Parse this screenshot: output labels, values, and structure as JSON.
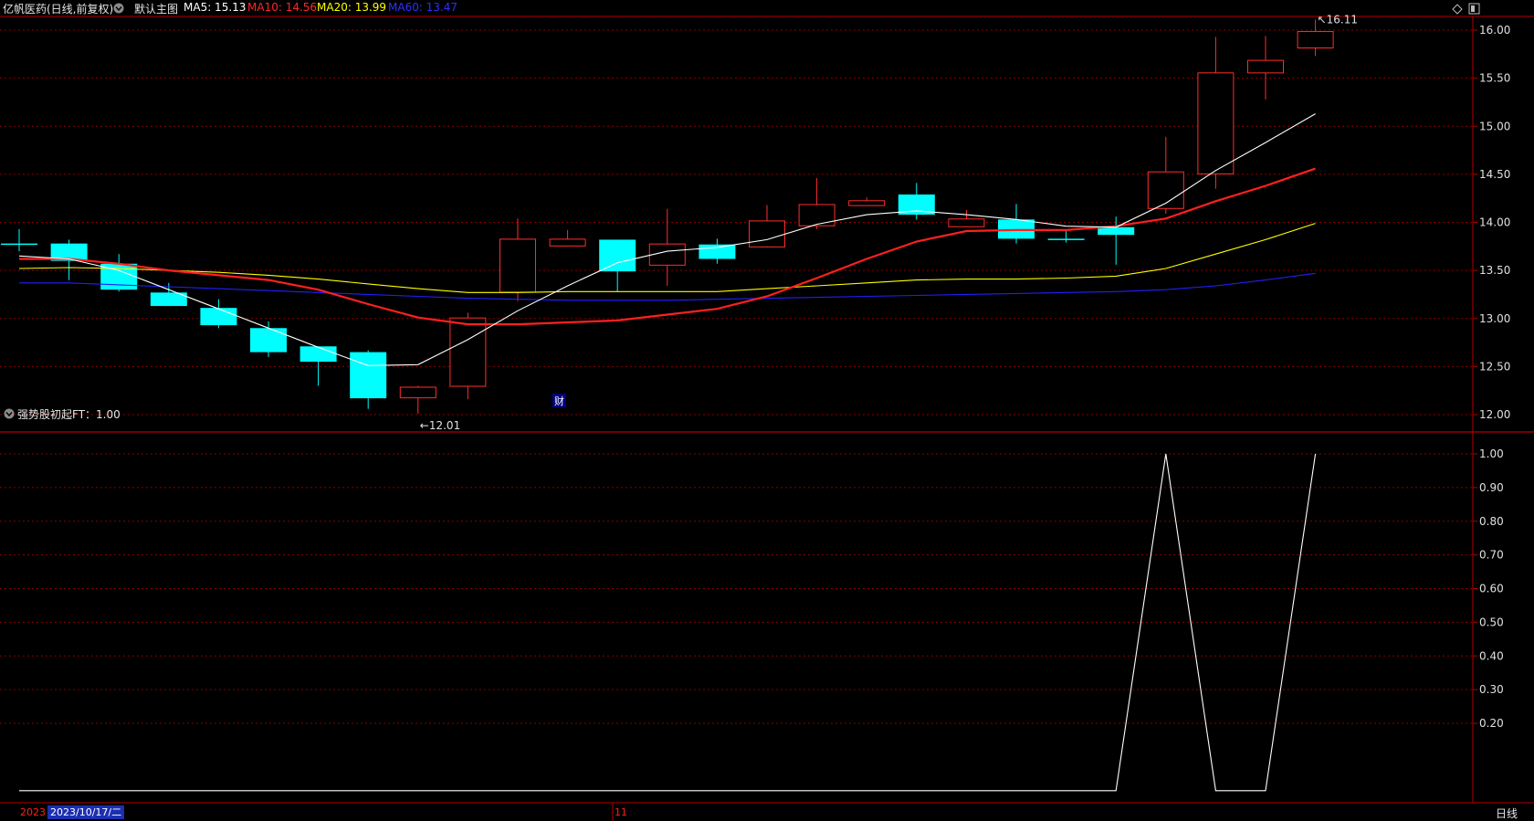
{
  "header": {
    "stock_title": "亿帆医药(日线,前复权)",
    "template_label": "默认主图",
    "ma5_label": "MA5: 15.13",
    "ma10_label": "MA10: 14.56",
    "ma20_label": "MA20: 13.99",
    "ma60_label": "MA60: 13.47"
  },
  "indicator": {
    "label": "强势股初起FT：1.00"
  },
  "footer": {
    "year_label": "2023",
    "cursor_date": "2023/10/17/二",
    "month_label": "11",
    "period_label": "日线"
  },
  "colors": {
    "up": "#ff2d2d",
    "down": "#00ffff",
    "ma5": "#ffffff",
    "ma10": "#ff2020",
    "ma20": "#ffff00",
    "ma60": "#2020ff",
    "grid": "#8b0000",
    "axis": "#b30000",
    "indicator_line": "#ffffff"
  },
  "icons": {
    "settings": "diamond-icon",
    "maximize": "window-icon",
    "collapse": "chevron-down-icon"
  },
  "chart_data": [
    {
      "type": "candlestick",
      "title": "亿帆医药(日线,前复权)",
      "ylim": [
        11.8,
        16.2
      ],
      "y_ticks": [
        "16.00",
        "15.50",
        "15.00",
        "14.50",
        "14.00",
        "13.50",
        "13.00",
        "12.50",
        "12.00"
      ],
      "candles": [
        {
          "o": 13.78,
          "c": 13.78,
          "h": 13.93,
          "l": 13.7
        },
        {
          "o": 13.78,
          "c": 13.6,
          "h": 13.82,
          "l": 13.4
        },
        {
          "o": 13.57,
          "c": 13.3,
          "h": 13.67,
          "l": 13.28
        },
        {
          "o": 13.27,
          "c": 13.13,
          "h": 13.37,
          "l": 13.13
        },
        {
          "o": 13.11,
          "c": 12.93,
          "h": 13.2,
          "l": 12.9
        },
        {
          "o": 12.9,
          "c": 12.65,
          "h": 12.97,
          "l": 12.6
        },
        {
          "o": 12.71,
          "c": 12.55,
          "h": 12.71,
          "l": 12.3
        },
        {
          "o": 12.65,
          "c": 12.17,
          "h": 12.67,
          "l": 12.06
        },
        {
          "o": 12.17,
          "c": 12.29,
          "h": 12.3,
          "l": 12.01
        },
        {
          "o": 12.29,
          "c": 13.01,
          "h": 13.06,
          "l": 12.16
        },
        {
          "o": 13.27,
          "c": 13.83,
          "h": 14.04,
          "l": 13.18
        },
        {
          "o": 13.75,
          "c": 13.83,
          "h": 13.92,
          "l": 13.75
        },
        {
          "o": 13.82,
          "c": 13.49,
          "h": 13.82,
          "l": 13.28
        },
        {
          "o": 13.55,
          "c": 13.78,
          "h": 14.14,
          "l": 13.34
        },
        {
          "o": 13.77,
          "c": 13.62,
          "h": 13.83,
          "l": 13.57
        },
        {
          "o": 13.74,
          "c": 14.02,
          "h": 14.18,
          "l": 13.74
        },
        {
          "o": 13.96,
          "c": 14.19,
          "h": 14.46,
          "l": 13.93
        },
        {
          "o": 14.17,
          "c": 14.23,
          "h": 14.26,
          "l": 14.17
        },
        {
          "o": 14.29,
          "c": 14.08,
          "h": 14.41,
          "l": 14.03
        },
        {
          "o": 13.95,
          "c": 14.04,
          "h": 14.13,
          "l": 13.95
        },
        {
          "o": 14.03,
          "c": 13.83,
          "h": 14.19,
          "l": 13.78
        },
        {
          "o": 13.83,
          "c": 13.83,
          "h": 13.91,
          "l": 13.79
        },
        {
          "o": 13.95,
          "c": 13.87,
          "h": 14.06,
          "l": 13.56
        },
        {
          "o": 14.14,
          "c": 14.53,
          "h": 14.89,
          "l": 14.09
        },
        {
          "o": 14.5,
          "c": 15.56,
          "h": 15.93,
          "l": 14.35
        },
        {
          "o": 15.55,
          "c": 15.69,
          "h": 15.94,
          "l": 15.28
        },
        {
          "o": 15.81,
          "c": 15.99,
          "h": 16.11,
          "l": 15.73
        }
      ],
      "ma5": [
        13.65,
        13.62,
        13.5,
        13.3,
        13.1,
        12.9,
        12.7,
        12.51,
        12.52,
        12.78,
        13.08,
        13.34,
        13.58,
        13.7,
        13.74,
        13.82,
        13.98,
        14.08,
        14.12,
        14.08,
        14.03,
        13.96,
        13.95,
        14.2,
        14.54,
        14.83,
        15.13
      ],
      "ma10": [
        13.62,
        13.62,
        13.57,
        13.5,
        13.45,
        13.4,
        13.3,
        13.15,
        13.01,
        12.94,
        12.94,
        12.96,
        12.98,
        13.04,
        13.1,
        13.23,
        13.42,
        13.62,
        13.8,
        13.91,
        13.92,
        13.92,
        13.96,
        14.04,
        14.22,
        14.38,
        14.56
      ],
      "ma20": [
        13.52,
        13.53,
        13.52,
        13.5,
        13.48,
        13.45,
        13.41,
        13.36,
        13.31,
        13.27,
        13.27,
        13.28,
        13.28,
        13.28,
        13.28,
        13.31,
        13.34,
        13.37,
        13.4,
        13.41,
        13.41,
        13.42,
        13.44,
        13.52,
        13.67,
        13.82,
        13.99
      ],
      "ma60": [
        13.37,
        13.37,
        13.35,
        13.33,
        13.31,
        13.29,
        13.27,
        13.25,
        13.23,
        13.21,
        13.2,
        13.19,
        13.19,
        13.19,
        13.2,
        13.21,
        13.22,
        13.23,
        13.24,
        13.25,
        13.26,
        13.27,
        13.28,
        13.3,
        13.34,
        13.4,
        13.47
      ],
      "annotations": {
        "high_label": "16.11",
        "low_label": "12.01",
        "finance_marker": "财"
      }
    },
    {
      "type": "line",
      "title": "强势股初起FT",
      "ylim": [
        0,
        1.05
      ],
      "y_ticks": [
        "1.00",
        "0.90",
        "0.80",
        "0.70",
        "0.60",
        "0.50",
        "0.40",
        "0.30",
        "0.20"
      ],
      "values": [
        0,
        0,
        0,
        0,
        0,
        0,
        0,
        0,
        0,
        0,
        0,
        0,
        0,
        0,
        0,
        0,
        0,
        0,
        0,
        0,
        0,
        0,
        0,
        1,
        0,
        0,
        1
      ]
    }
  ]
}
